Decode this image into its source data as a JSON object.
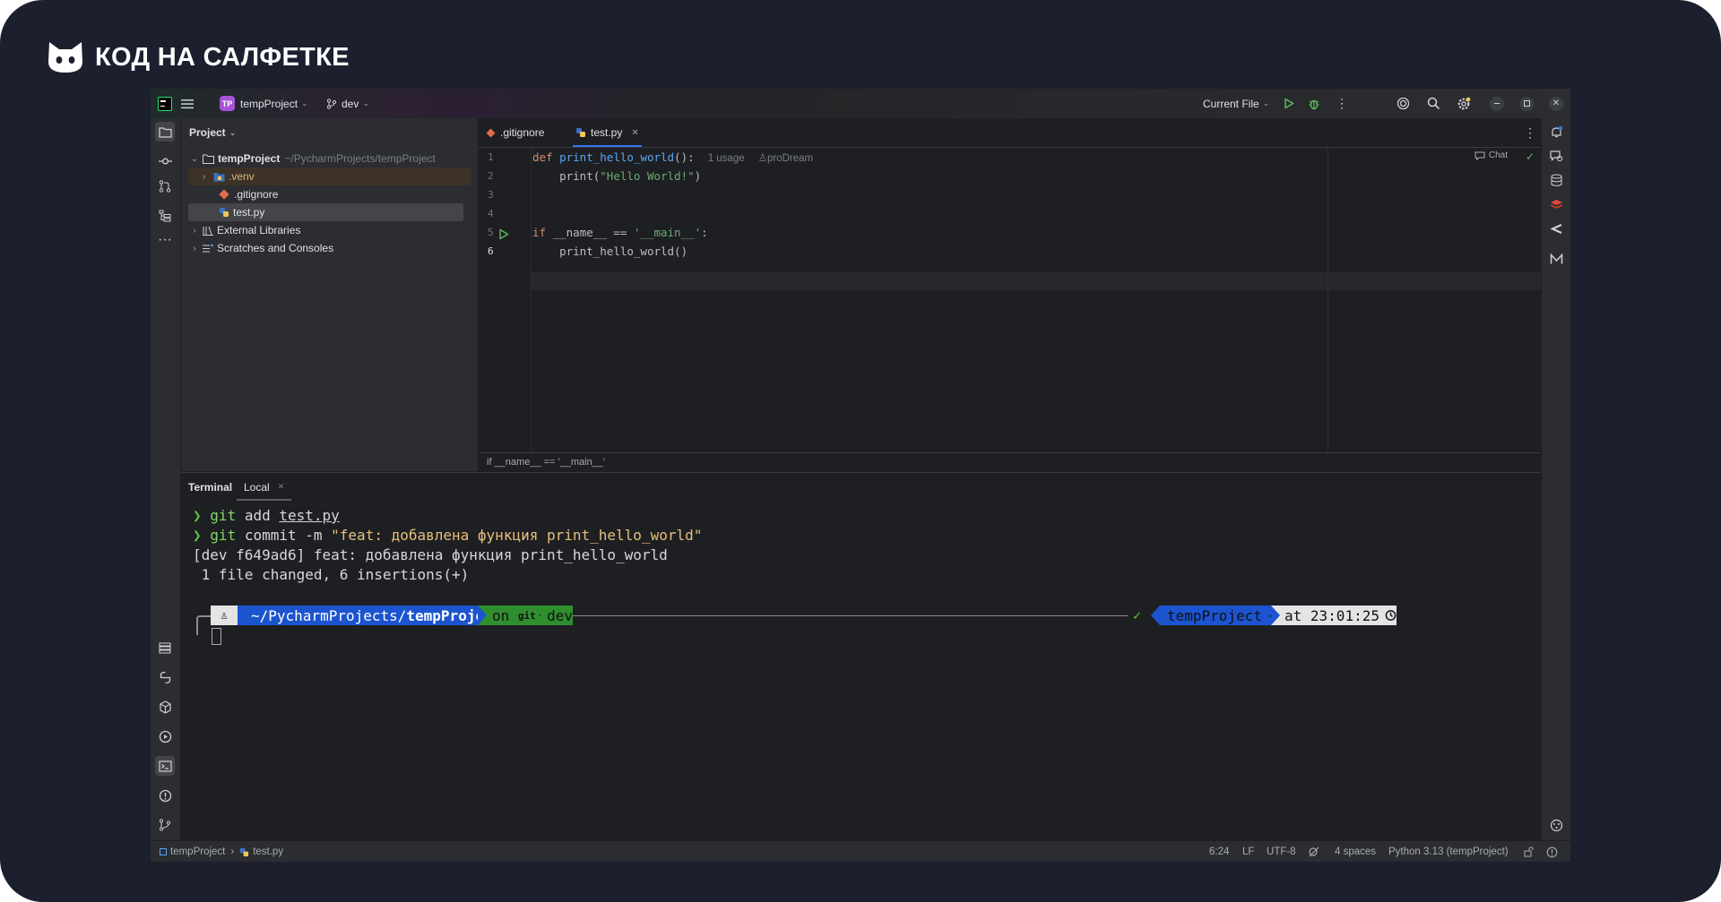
{
  "brand": {
    "name": "КОД НА САЛФЕТКЕ"
  },
  "titlebar": {
    "project_badge": "TP",
    "project_name": "tempProject",
    "branch": "dev",
    "run_config": "Current File"
  },
  "project_panel": {
    "title": "Project",
    "root_name": "tempProject",
    "root_path": "~/PycharmProjects/tempProject",
    "items": [
      ".venv",
      ".gitignore",
      "test.py"
    ],
    "external_libraries": "External Libraries",
    "scratches": "Scratches and Consoles"
  },
  "editor": {
    "tabs": [
      ".gitignore",
      "test.py"
    ],
    "active_tab": "test.py",
    "line_numbers": [
      "1",
      "2",
      "3",
      "4",
      "5",
      "6"
    ],
    "code": {
      "l1_kw": "def",
      "l1_fn": "print_hello_world",
      "l1_rest": "():",
      "l1_usage": "1 usage",
      "l1_author": "proDream",
      "l2_call": "print(",
      "l2_str": "\"Hello World!\"",
      "l2_end": ")",
      "l5_kw": "if",
      "l5_mid": " __name__ == ",
      "l5_str": "'__main__'",
      "l5_end": ":",
      "l6": "print_hello_world()"
    },
    "chat_label": "Chat",
    "breadcrumb": "if __name__ == '__main__'"
  },
  "terminal": {
    "title": "Terminal",
    "tab": "Local",
    "lines": {
      "l1_cmd": "git",
      "l1_args": " add ",
      "l1_file": "test.py",
      "l2_cmd": "git",
      "l2_args": " commit -m ",
      "l2_msg": "\"feat: добавлена функция print_hello_world\"",
      "l3": "[dev f649ad6] feat: добавлена функция print_hello_world",
      "l4": " 1 file changed, 6 insertions(+)"
    },
    "prompt": {
      "path_prefix": "~/PycharmProjects/",
      "path_dir": "tempProject",
      "git_on": "on ",
      "git_word": "git",
      "branch": "dev",
      "check": "✓",
      "env": "tempProject",
      "time_prefix": "at ",
      "time": "23:01:25"
    }
  },
  "statusbar": {
    "crumb_project": "tempProject",
    "crumb_file": "test.py",
    "position": "6:24",
    "line_sep": "LF",
    "encoding": "UTF-8",
    "indent": "4 spaces",
    "interpreter": "Python 3.13 (tempProject)"
  },
  "colors": {
    "frame_bg": "#1c1f2e",
    "ide_bg": "#1e1f22",
    "panel_bg": "#2b2d30",
    "accent_blue": "#3574f0",
    "prompt_blue": "#1c54cf",
    "prompt_green": "#2f8f2f",
    "run_green": "#5fb85f"
  }
}
